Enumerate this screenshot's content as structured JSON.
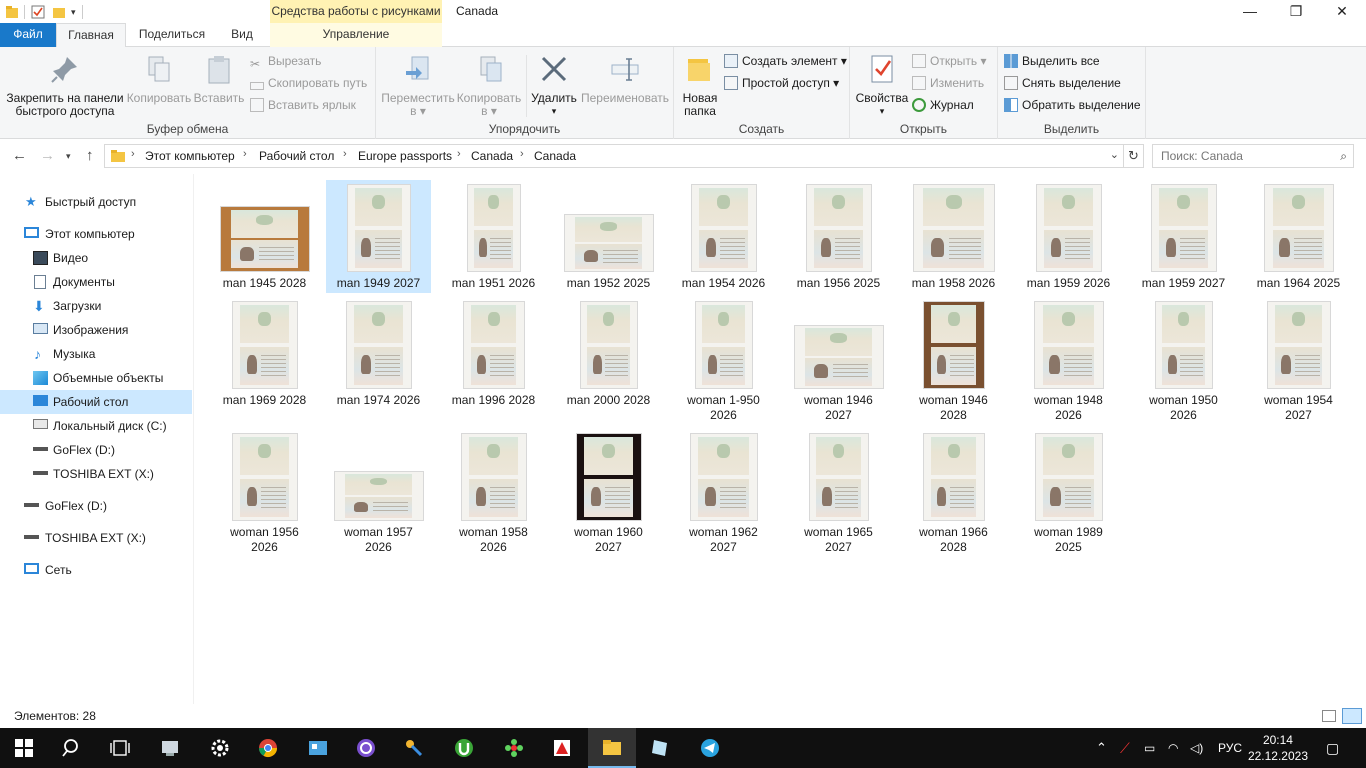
{
  "window": {
    "title": "Canada",
    "context_group": "Средства работы с рисунками",
    "controls": {
      "minimize": "—",
      "maximize": "❐",
      "close": "✕"
    }
  },
  "ribbon_tabs": {
    "file": "Файл",
    "home": "Главная",
    "share": "Поделиться",
    "view": "Вид",
    "manage": "Управление",
    "collapse": "⌃",
    "help": "?"
  },
  "ribbon": {
    "clipboard": {
      "label": "Буфер обмена",
      "pin_line1": "Закрепить на панели",
      "pin_line2": "быстрого доступа",
      "copy": "Копировать",
      "paste": "Вставить",
      "cut": "Вырезать",
      "copy_path": "Скопировать путь",
      "paste_shortcut": "Вставить ярлык"
    },
    "organize": {
      "label": "Упорядочить",
      "move_line1": "Переместить",
      "move_line2": "в ▾",
      "copyto_line1": "Копировать",
      "copyto_line2": "в ▾",
      "delete": "Удалить",
      "delete_arrow": "▾",
      "rename": "Переименовать"
    },
    "create": {
      "label": "Создать",
      "newfolder_line1": "Новая",
      "newfolder_line2": "папка",
      "new_item": "Создать элемент ▾",
      "easy_access": "Простой доступ ▾"
    },
    "open": {
      "label": "Открыть",
      "properties": "Свойства",
      "properties_arrow": "▾",
      "open": "Открыть ▾",
      "edit": "Изменить",
      "history": "Журнал"
    },
    "select": {
      "label": "Выделить",
      "select_all": "Выделить все",
      "select_none": "Снять выделение",
      "invert": "Обратить выделение"
    }
  },
  "address": {
    "crumbs": [
      "Этот компьютер",
      "Рабочий стол",
      "Europe passports",
      "Canada",
      "Canada"
    ],
    "search_placeholder": "Поиск: Canada"
  },
  "nav": {
    "quick_access": "Быстрый доступ",
    "this_pc": "Этот компьютер",
    "video": "Видео",
    "documents": "Документы",
    "downloads": "Загрузки",
    "pictures": "Изображения",
    "music": "Музыка",
    "objects3d": "Объемные объекты",
    "desktop": "Рабочий стол",
    "local_disk": "Локальный диск (C:)",
    "goflex_sub": "GoFlex  (D:)",
    "toshiba_sub": "TOSHIBA EXT (X:)",
    "goflex": "GoFlex  (D:)",
    "toshiba": "TOSHIBA EXT (X:)",
    "network": "Сеть"
  },
  "files": [
    {
      "l1": "man 1945 2028",
      "l2": ""
    },
    {
      "l1": "man 1949  2027",
      "l2": ""
    },
    {
      "l1": "man 1951 2026",
      "l2": ""
    },
    {
      "l1": "man 1952 2025",
      "l2": ""
    },
    {
      "l1": "man 1954 2026",
      "l2": ""
    },
    {
      "l1": "man 1956 2025",
      "l2": ""
    },
    {
      "l1": "man 1958 2026",
      "l2": ""
    },
    {
      "l1": "man 1959 2026",
      "l2": ""
    },
    {
      "l1": "man 1959 2027",
      "l2": ""
    },
    {
      "l1": "man 1964 2025",
      "l2": ""
    },
    {
      "l1": "man 1969 2028",
      "l2": ""
    },
    {
      "l1": "man 1974 2026",
      "l2": ""
    },
    {
      "l1": "man 1996 2028",
      "l2": ""
    },
    {
      "l1": "man 2000 2028",
      "l2": ""
    },
    {
      "l1": "woman 1-950",
      "l2": "2026"
    },
    {
      "l1": "woman 1946",
      "l2": "2027"
    },
    {
      "l1": "woman 1946",
      "l2": "2028"
    },
    {
      "l1": "woman 1948",
      "l2": "2026"
    },
    {
      "l1": "woman 1950",
      "l2": "2026"
    },
    {
      "l1": "woman 1954",
      "l2": "2027"
    },
    {
      "l1": "woman 1956",
      "l2": "2026"
    },
    {
      "l1": "woman 1957",
      "l2": "2026"
    },
    {
      "l1": "woman 1958",
      "l2": "2026"
    },
    {
      "l1": "woman 1960",
      "l2": "2027"
    },
    {
      "l1": "woman 1962",
      "l2": "2027"
    },
    {
      "l1": "woman 1965",
      "l2": "2027"
    },
    {
      "l1": "woman 1966",
      "l2": "2028"
    },
    {
      "l1": "woman 1989",
      "l2": "2025"
    }
  ],
  "status": {
    "items_count": "Элементов: 28"
  },
  "taskbar": {
    "lang": "РУС",
    "time": "20:14",
    "date": "22.12.2023"
  },
  "colors": {
    "accent": "#1979ca",
    "selection": "#cce8ff",
    "context_tab": "#fff2b3",
    "taskbar": "#101010"
  }
}
